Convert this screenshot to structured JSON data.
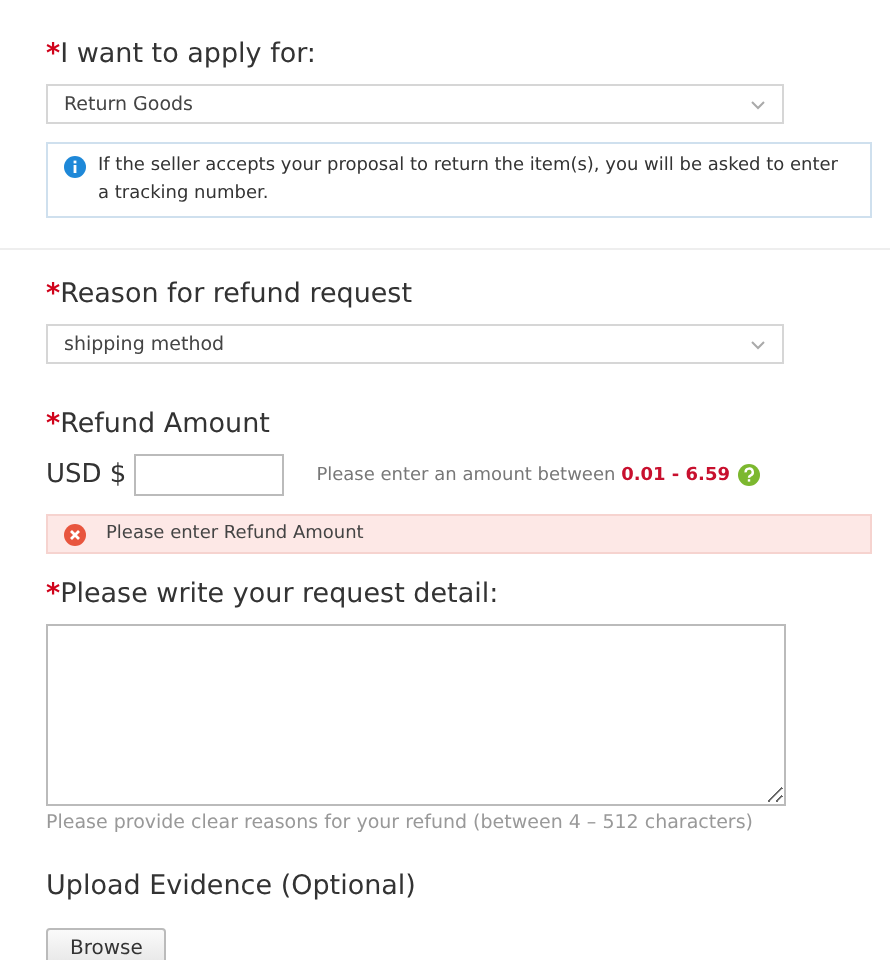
{
  "apply": {
    "required_mark": "*",
    "label": "I want to apply for:",
    "value": "Return Goods",
    "info": "If the seller accepts your proposal to return the item(s), you will be asked to enter a tracking number."
  },
  "reason": {
    "required_mark": "*",
    "label": "Reason for refund request",
    "value": "shipping method"
  },
  "amount": {
    "required_mark": "*",
    "label": "Refund Amount",
    "currency": "USD $",
    "hint": "Please enter an amount between **0.01 - 6.59**",
    "error": "Please enter Refund Amount"
  },
  "detail": {
    "required_mark": "*",
    "label": "Please write your request detail:",
    "hint": "Please provide clear reasons for your refund (between 4 – 512 characters)"
  },
  "upload": {
    "label": "Upload Evidence (Optional)",
    "button": "Browse"
  }
}
